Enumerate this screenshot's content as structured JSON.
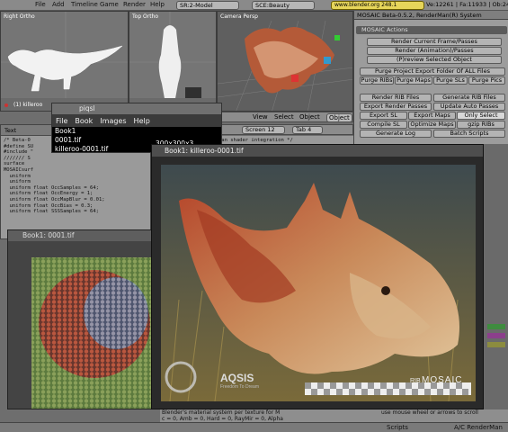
{
  "topbar": {
    "menu": [
      "File",
      "Add",
      "Timeline",
      "Game",
      "Render",
      "Help"
    ],
    "screen_field": "SR:2-Model",
    "scene_field": "SCE:Beauty",
    "url": "www.blender.org 248.1",
    "stats": "Ve:12261 | Fa:11933 | Ob:24-1 |"
  },
  "viewports": {
    "right_ortho": "Right Ortho",
    "top_ortho": "Top Ortho",
    "camera_persp": "Camera Persp",
    "object_label": "(1) killeroo"
  },
  "midbar": {
    "view": "View",
    "select": "Select",
    "object": "Object",
    "object_mode": "Object"
  },
  "screenbar": {
    "screen": "Screen 12",
    "tab": "Tab 4"
  },
  "code_snippet": "man shader integration */",
  "mosaic": {
    "title": "MOSAIC Beta-0.5.2, RenderMan(R) System",
    "actions_label": "MOSAIC Actions",
    "buttons": [
      "Render Current Frame/Passes",
      "Render (Animation)/Passes",
      "(P)review Selected Object",
      "Purge Project Export Folder Of ALL Files",
      "Purge RIBs",
      "Purge Maps",
      "Purge SLs",
      "Purge Pics",
      "Render RIB Files",
      "Generate RIB Files",
      "Export Render Passes",
      "Update Auto Passes",
      "Export SL",
      "Export Maps",
      "Only Select",
      "Compile SL",
      "Optimize Maps",
      "gzip RIBs",
      "Generate Log",
      "Batch Scripts"
    ]
  },
  "text_editor": {
    "header": "Text",
    "lines": [
      "/* Beta-0",
      "",
      "#define SU",
      "#include \"",
      "",
      "/////// S",
      "surface",
      "MOSAICsurf",
      "  uniform",
      "  uniform",
      "  uniform float OccSamples = 64;",
      "  uniform float OccEnergy = 1;",
      "  uniform float OccMapBlur = 0.01;",
      "  uniform float OccBias = 0.3;",
      "  uniform float SSSSamples = 64;"
    ]
  },
  "piqsl": {
    "title": "piqsl",
    "menu": [
      "File",
      "Book",
      "Images",
      "Help"
    ],
    "items": [
      "Book1",
      "0001.tif",
      "killeroo-0001.tif"
    ],
    "resolution": "300x300x3"
  },
  "book_small": {
    "title": "Book1: 0001.tif"
  },
  "book_main": {
    "title": "Book1: killeroo-0001.tif",
    "logo_aqsis": "AQSIS",
    "logo_tagline": "Freedom To Dream",
    "logo_rib": "RIB",
    "logo_mosaic": "MOSAIC"
  },
  "status": {
    "left_line1": "Blender's material system per texture for M",
    "left_line2": "c = 0, Amb = 0, Hard = 0, RayMir = 0, Alpha",
    "right": "use mouse wheel or arrows to scroll"
  },
  "bottombar": {
    "scripts": "Scripts",
    "window": "A/C RenderMan"
  },
  "colors": {
    "background": "#6e6e6e",
    "url_bg": "#e6d55a",
    "panel": "#9c9c9c"
  }
}
